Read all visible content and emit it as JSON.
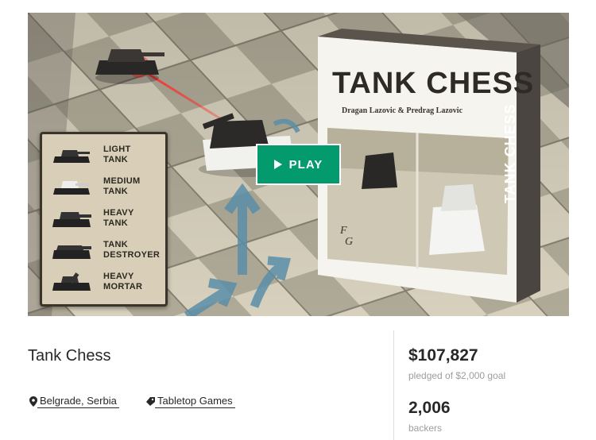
{
  "video": {
    "play_label": "PLAY",
    "legend": [
      {
        "label": "LIGHT\nTANK"
      },
      {
        "label": "MEDIUM\nTANK"
      },
      {
        "label": "HEAVY\nTANK"
      },
      {
        "label": "TANK\nDESTROYER"
      },
      {
        "label": "HEAVY\nMORTAR"
      }
    ],
    "box": {
      "title": "TANK CHESS",
      "authors": "Dragan Lazovic & Predrag Lazovic",
      "side_title": "TANK CHESS",
      "logo_top": "F",
      "logo_bottom": "G"
    }
  },
  "project": {
    "title": "Tank Chess",
    "location": "Belgrade, Serbia",
    "category": "Tabletop Games",
    "location_icon": "map-pin-icon",
    "category_icon": "tag-icon"
  },
  "stats": {
    "pledged_amount": "$107,827",
    "pledged_label": "pledged of $2,000 goal",
    "backers_count": "2,006",
    "backers_label": "backers"
  },
  "colors": {
    "accent": "#039b6e",
    "text": "#282828",
    "muted": "#9b9e9e"
  }
}
